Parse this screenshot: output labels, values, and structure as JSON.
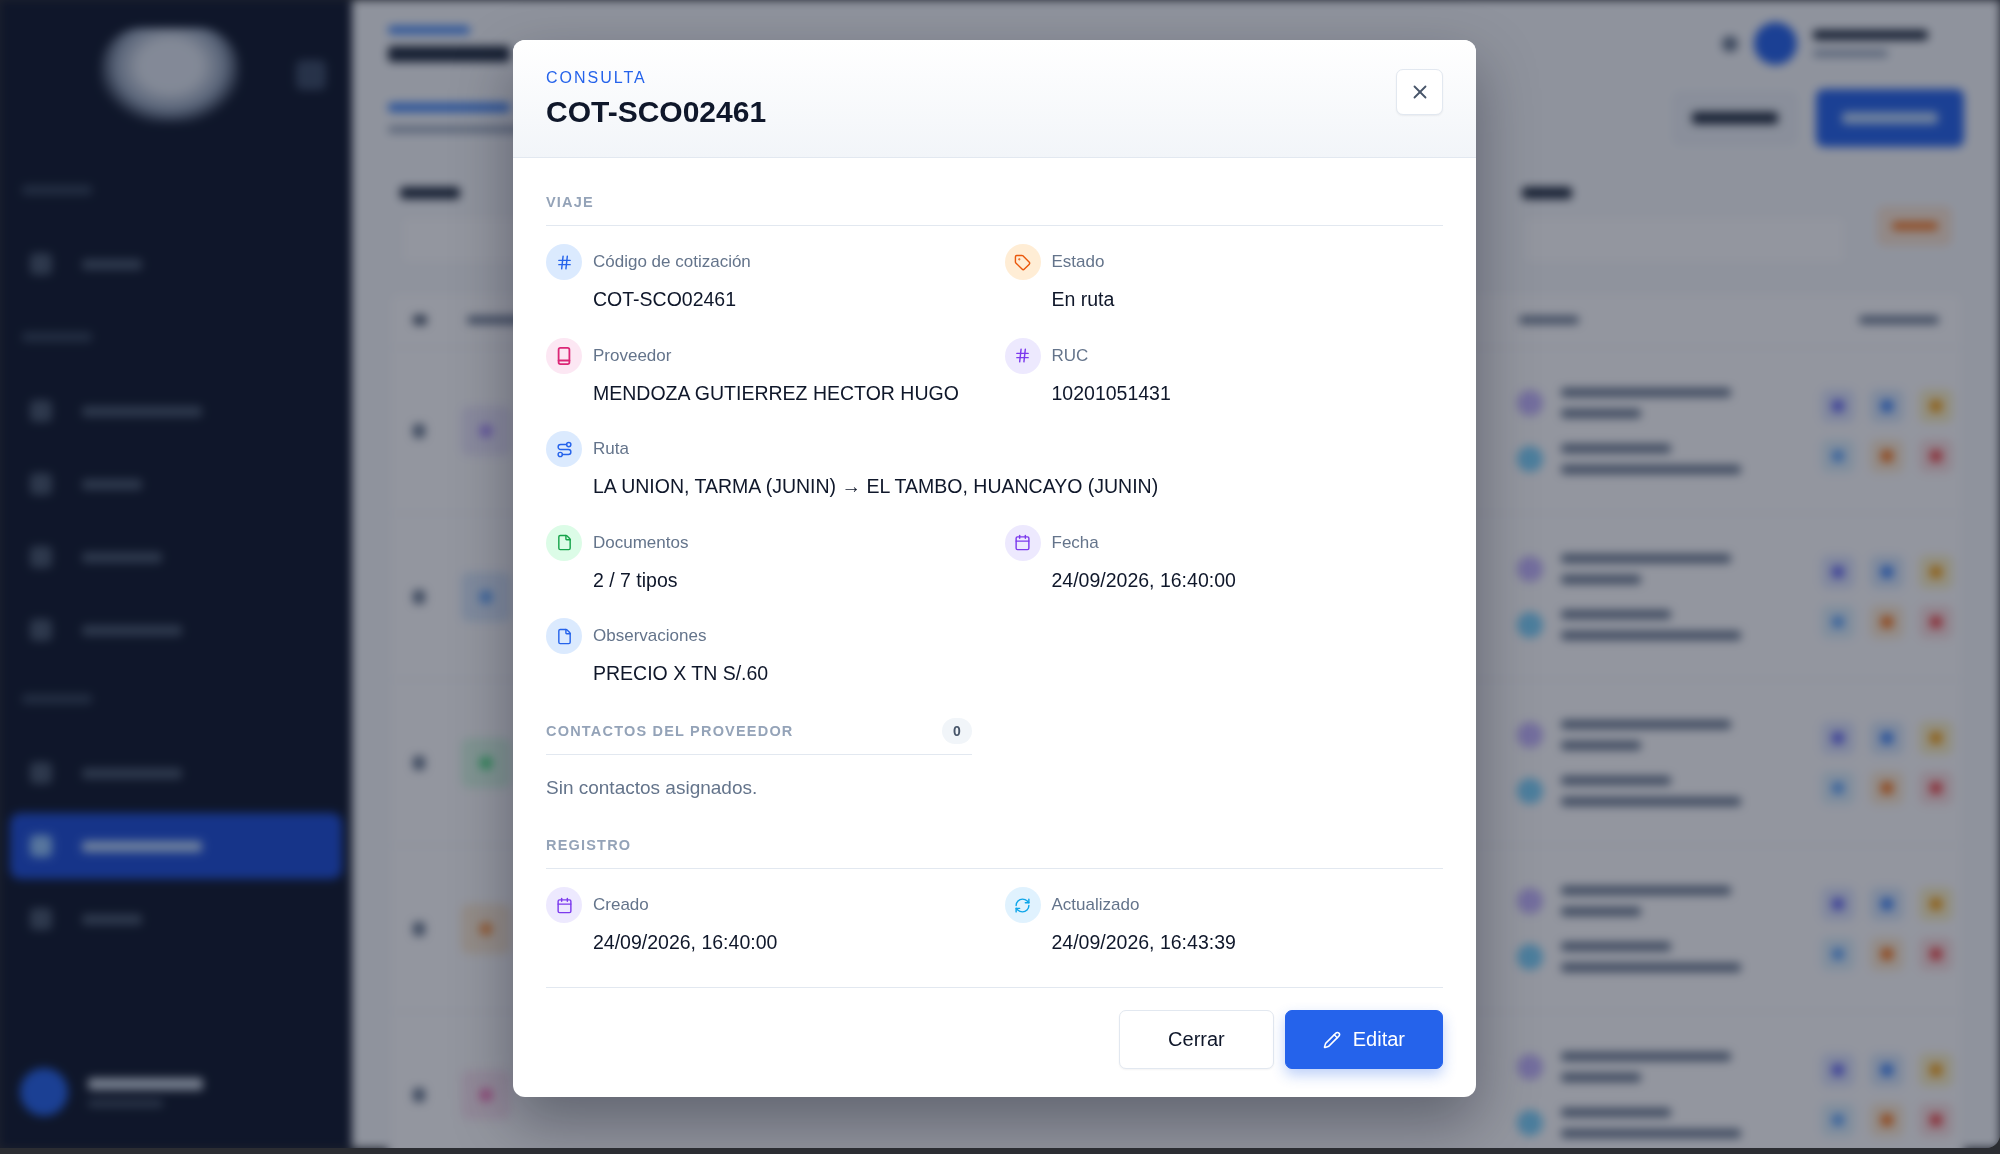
{
  "dialog": {
    "eyebrow": "CONSULTA",
    "title": "COT-SCO02461",
    "sections": [
      {
        "kind": "fields",
        "title": "VIAJE",
        "rows": [
          [
            {
              "kind": "code",
              "label": "Código de cotización",
              "value": "COT-SCO02461"
            },
            {
              "kind": "status",
              "label": "Estado",
              "value": "En ruta"
            }
          ],
          [
            {
              "kind": "supplier",
              "label": "Proveedor",
              "value": "MENDOZA GUTIERREZ HECTOR HUGO"
            },
            {
              "kind": "tax_id",
              "label": "RUC",
              "value": "10201051431"
            }
          ],
          [
            {
              "kind": "route",
              "label": "Ruta",
              "value": "LA UNION, TARMA (JUNIN) → EL TAMBO, HUANCAYO (JUNIN)"
            }
          ],
          [
            {
              "kind": "documents",
              "label": "Documentos",
              "value": "2 / 7 tipos"
            },
            {
              "kind": "date",
              "label": "Fecha",
              "value": "24/09/2026, 16:40:00"
            }
          ],
          [
            {
              "kind": "notes",
              "label": "Observaciones",
              "value": "PRECIO X TN S/.60"
            }
          ]
        ]
      },
      {
        "kind": "contacts",
        "title": "CONTACTOS DEL PROVEEDOR",
        "count": "0",
        "empty_text": "Sin contactos asignados."
      },
      {
        "kind": "fields",
        "title": "REGISTRO",
        "rows": [
          [
            {
              "kind": "created",
              "label": "Creado",
              "value": "24/09/2026, 16:40:00"
            },
            {
              "kind": "updated",
              "label": "Actualizado",
              "value": "24/09/2026, 16:43:39"
            }
          ]
        ]
      }
    ],
    "buttons": [
      {
        "kind": "cancel",
        "label": "Cerrar"
      },
      {
        "kind": "edit",
        "label": "Editar"
      }
    ]
  }
}
